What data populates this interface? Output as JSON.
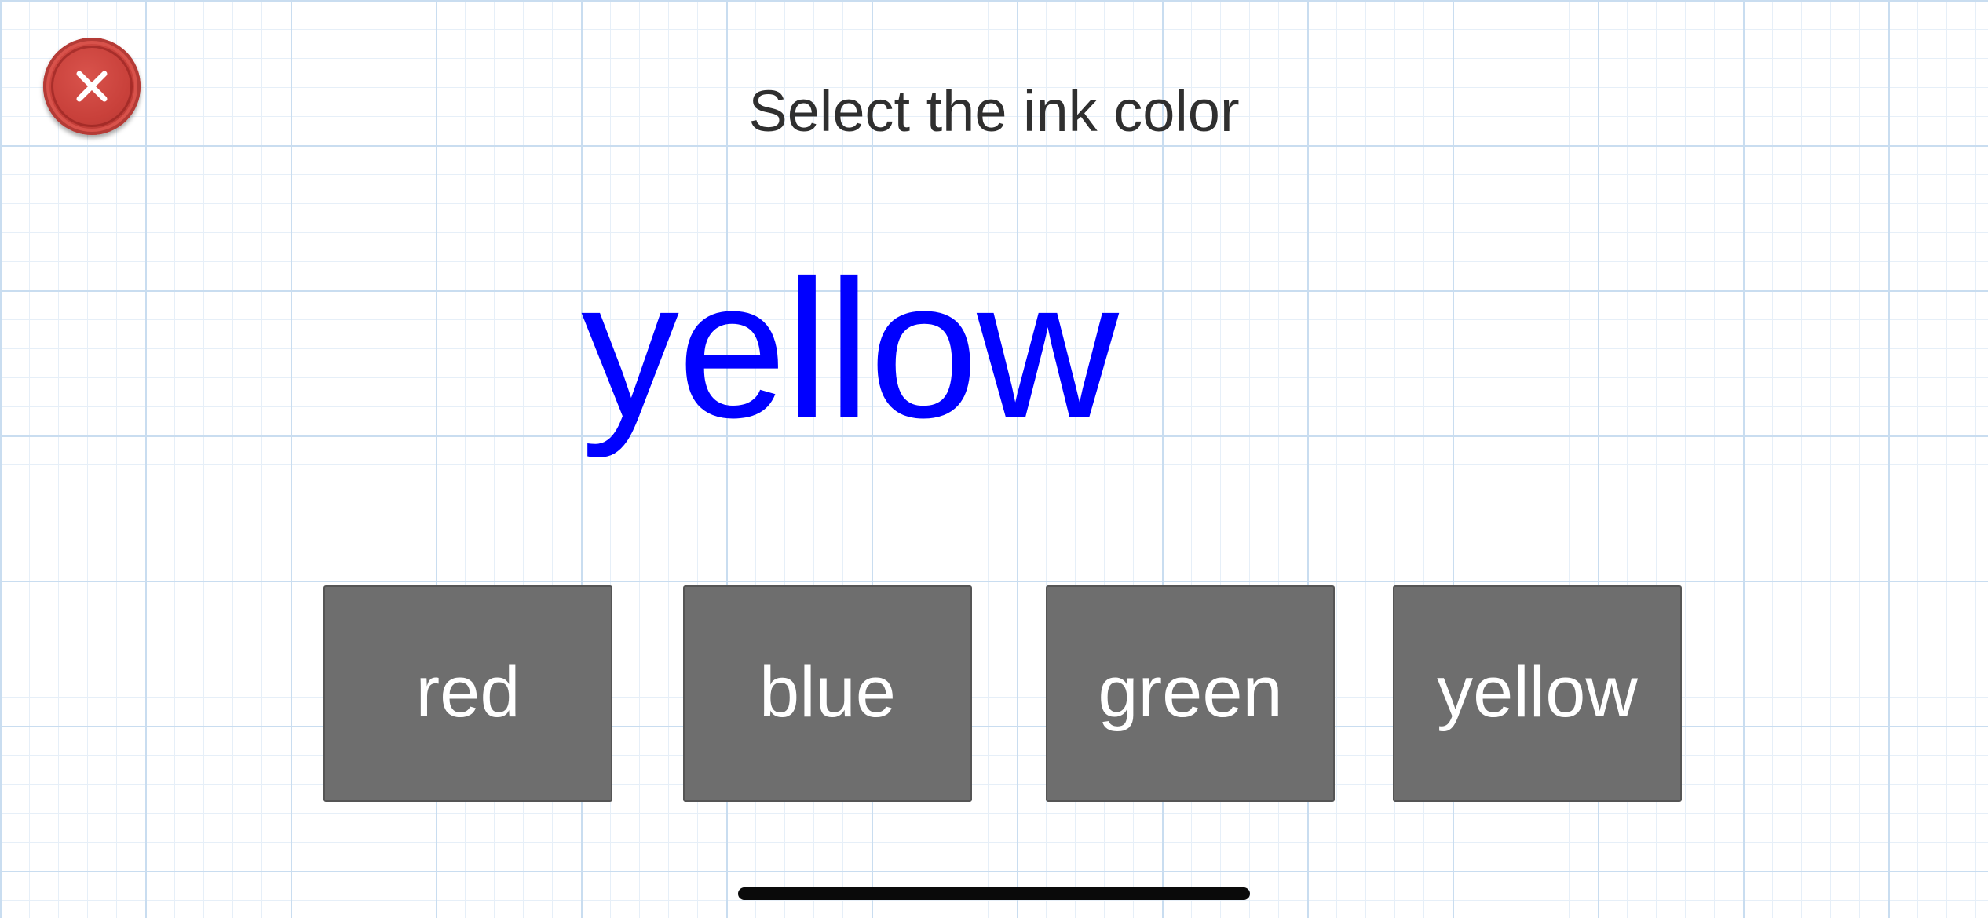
{
  "header": {
    "close_icon": "close-icon",
    "instruction": "Select the ink color"
  },
  "stimulus": {
    "word": "yellow",
    "ink_color": "#0000ff"
  },
  "answers": [
    {
      "label": "red"
    },
    {
      "label": "blue"
    },
    {
      "label": "green"
    },
    {
      "label": "yellow"
    }
  ],
  "theme": {
    "button_color": "#6e6e6e",
    "close_button_color": "#c8403a",
    "grid_color": "#c9ddf0"
  }
}
